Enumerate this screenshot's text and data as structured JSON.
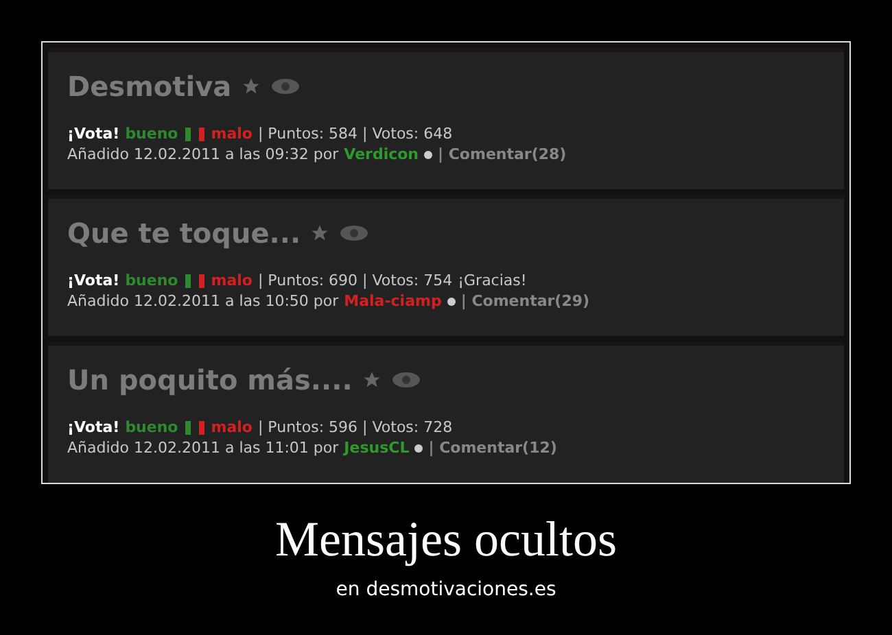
{
  "posts": [
    {
      "title": "Desmotiva",
      "vote_label": "¡Vota!",
      "good": "bueno",
      "bad": "malo",
      "stats": "| Puntos: 584 | Votos: 648",
      "added": "Añadido 12.02.2011 a las 09:32 por",
      "author": "Verdicon",
      "color": "#2e9a2e",
      "comments": "| Comentar(28)"
    },
    {
      "title": "Que te toque...",
      "vote_label": "¡Vota!",
      "good": "bueno",
      "bad": "malo",
      "stats": "| Puntos: 690 | Votos: 754",
      "thanks": "¡Gracias!",
      "added": "Añadido 12.02.2011 a las 10:50 por",
      "author": "Mala-ciamp",
      "color": "#d42020",
      "comments": "| Comentar(29)"
    },
    {
      "title": "Un poquito más....",
      "vote_label": "¡Vota!",
      "good": "bueno",
      "bad": "malo",
      "stats": "| Puntos: 596 | Votos: 728",
      "added": "Añadido 12.02.2011 a las 11:01 por",
      "author": "JesusCL",
      "color": "#2e9a2e",
      "comments": "| Comentar(12)"
    }
  ],
  "caption": {
    "title": "Mensajes ocultos",
    "subtitle": "en desmotivaciones.es"
  }
}
